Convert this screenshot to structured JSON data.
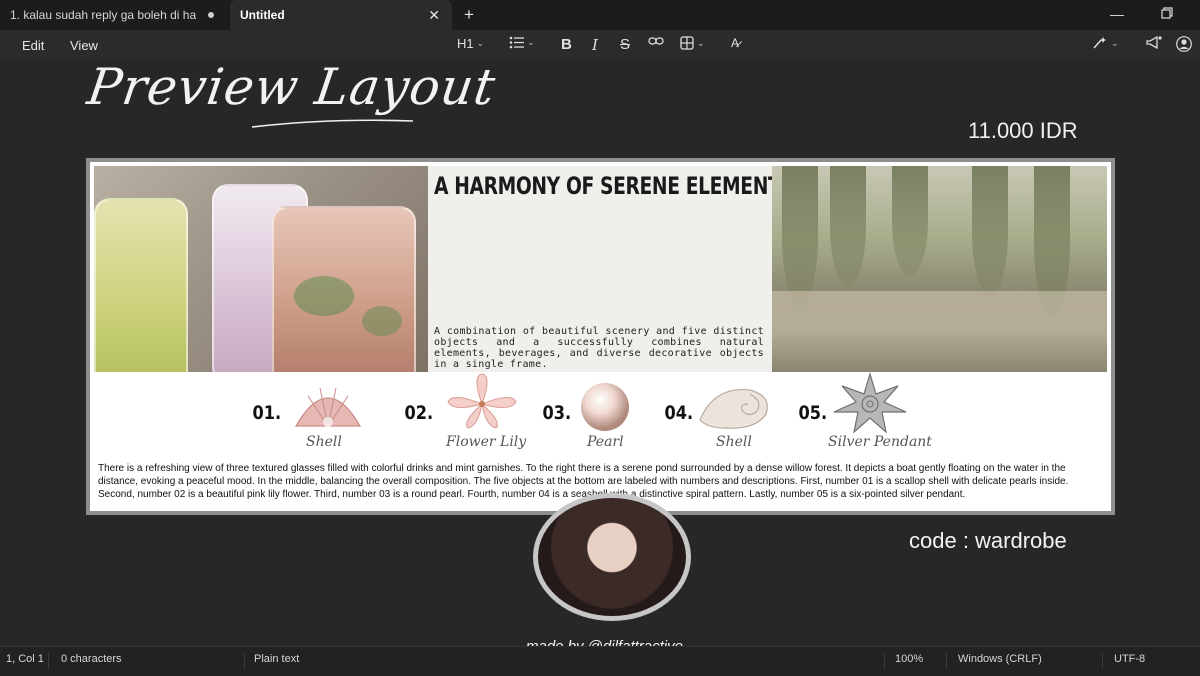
{
  "tabs": [
    {
      "label": "1. kalau sudah reply ga boleh di ha",
      "modified": true
    },
    {
      "label": "Untitled",
      "active": true
    }
  ],
  "menu": {
    "edit": "Edit",
    "view": "View"
  },
  "toolbar": {
    "heading": "H1",
    "icons": [
      "bullet-list-icon",
      "bold-icon",
      "italic-icon",
      "strikethrough-icon",
      "link-icon",
      "table-icon",
      "clear-format-icon",
      "copilot-icon",
      "announcement-icon",
      "account-icon"
    ]
  },
  "doc": {
    "title": "Preview Layout",
    "price": "11.000 IDR",
    "code": "code : wardrobe",
    "made_by": "made by @dilfattractive"
  },
  "layout_card": {
    "headline": "A HARMONY OF SERENE ELEMENTS",
    "headline_desc": "A combination of beautiful scenery and five distinct objects and a successfully combines natural elements, beverages, and diverse decorative objects in a single frame.",
    "items": [
      {
        "num": "01.",
        "label": "Shell"
      },
      {
        "num": "02.",
        "label": "Flower Lily"
      },
      {
        "num": "03.",
        "label": "Pearl"
      },
      {
        "num": "04.",
        "label": "Shell"
      },
      {
        "num": "05.",
        "label": "Silver Pendant"
      }
    ],
    "description": "There is a refreshing view of three textured glasses filled with colorful drinks and mint garnishes. To the right there is a serene pond surrounded by a dense willow forest. It depicts a boat gently floating on the water in the distance, evoking a peaceful mood. In the middle, balancing the overall composition. The five objects at the bottom are labeled with numbers and descriptions. First, number 01 is a scallop shell with delicate pearls inside. Second, number 02 is a beautiful pink lily flower. Third, number 03 is a round pearl. Fourth, number 04 is a seashell with a distinctive spiral pattern. Lastly, number 05 is a six-pointed silver pendant."
  },
  "status": {
    "position": "1, Col 1",
    "chars": "0 characters",
    "format": "Plain text",
    "zoom": "100%",
    "line_endings": "Windows (CRLF)",
    "encoding": "UTF-8"
  }
}
